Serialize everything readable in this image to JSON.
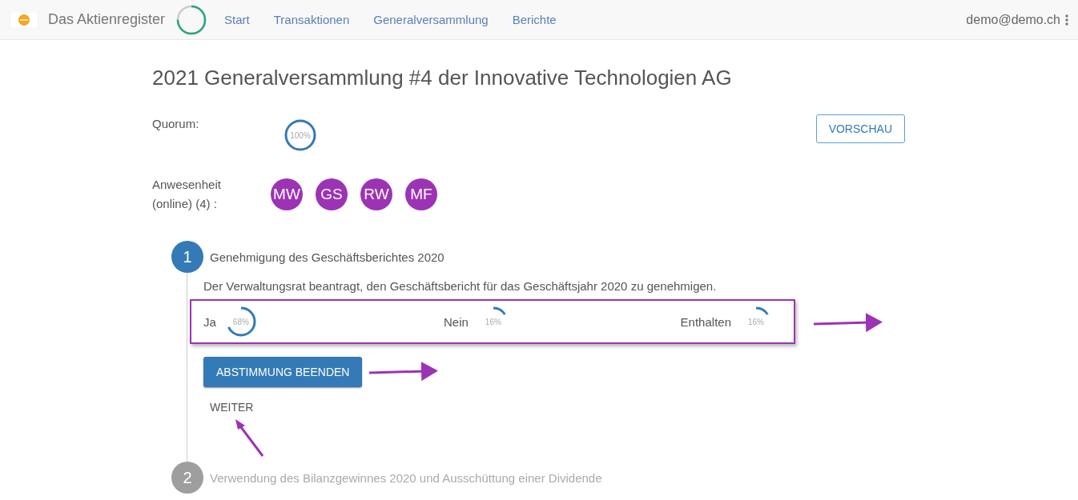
{
  "navbar": {
    "brand": "Das Aktienregister",
    "links": [
      {
        "label": "Start"
      },
      {
        "label": "Transaktionen"
      },
      {
        "label": "Generalversammlung"
      },
      {
        "label": "Berichte"
      }
    ],
    "user": "demo@demo.ch"
  },
  "title": "2021 Generalversammlung #4 der Innovative Technologien AG",
  "quorum": {
    "label": "Quorum:",
    "reading": "100%",
    "level": 1
  },
  "preview_button": "VORSCHAU",
  "attendance": {
    "label": "Anwesenheit (online) (4) :",
    "attendees": [
      {
        "initials": "MW"
      },
      {
        "initials": "GS"
      },
      {
        "initials": "RW"
      },
      {
        "initials": "MF"
      }
    ]
  },
  "steps": [
    {
      "number": "1",
      "title": "Genehmigung des Geschäftsberichtes 2020",
      "selected": true,
      "description": "Der Verwaltungsrat beantragt, den Geschäftsbericht für das Geschäftsjahr 2020 zu genehmigen.",
      "votes": [
        {
          "label": "Ja",
          "reading": "68%",
          "level": 0.68
        },
        {
          "label": "Nein",
          "reading": "16%",
          "level": 0.16
        },
        {
          "label": "Enthalten",
          "reading": "16%",
          "level": 0.16
        }
      ],
      "end_button": "ABSTIMMUNG BEENDEN",
      "next_link": "WEITER"
    },
    {
      "number": "2",
      "title": "Verwendung des Bilanzgewinnes 2020 und Ausschüttung einer Dividende",
      "selected": false
    }
  ]
}
